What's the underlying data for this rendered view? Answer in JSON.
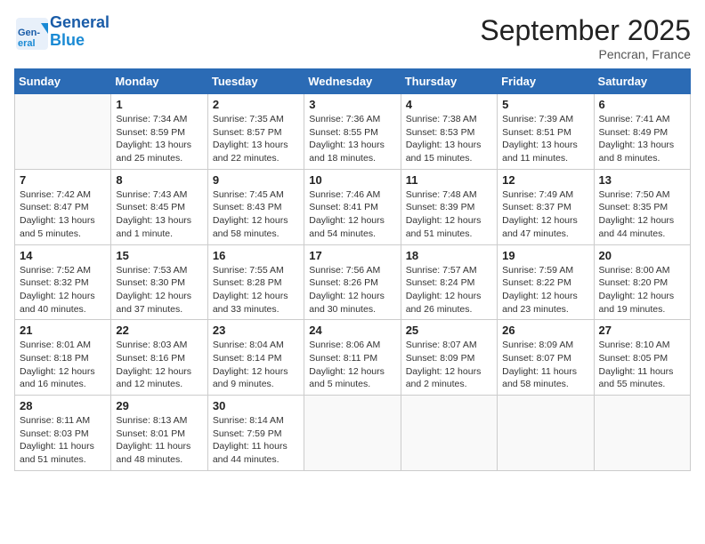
{
  "header": {
    "logo_general": "General",
    "logo_blue": "Blue",
    "month": "September 2025",
    "location": "Pencran, France"
  },
  "days_of_week": [
    "Sunday",
    "Monday",
    "Tuesday",
    "Wednesday",
    "Thursday",
    "Friday",
    "Saturday"
  ],
  "weeks": [
    [
      {
        "day": "",
        "info": ""
      },
      {
        "day": "1",
        "info": "Sunrise: 7:34 AM\nSunset: 8:59 PM\nDaylight: 13 hours and 25 minutes."
      },
      {
        "day": "2",
        "info": "Sunrise: 7:35 AM\nSunset: 8:57 PM\nDaylight: 13 hours and 22 minutes."
      },
      {
        "day": "3",
        "info": "Sunrise: 7:36 AM\nSunset: 8:55 PM\nDaylight: 13 hours and 18 minutes."
      },
      {
        "day": "4",
        "info": "Sunrise: 7:38 AM\nSunset: 8:53 PM\nDaylight: 13 hours and 15 minutes."
      },
      {
        "day": "5",
        "info": "Sunrise: 7:39 AM\nSunset: 8:51 PM\nDaylight: 13 hours and 11 minutes."
      },
      {
        "day": "6",
        "info": "Sunrise: 7:41 AM\nSunset: 8:49 PM\nDaylight: 13 hours and 8 minutes."
      }
    ],
    [
      {
        "day": "7",
        "info": "Sunrise: 7:42 AM\nSunset: 8:47 PM\nDaylight: 13 hours and 5 minutes."
      },
      {
        "day": "8",
        "info": "Sunrise: 7:43 AM\nSunset: 8:45 PM\nDaylight: 13 hours and 1 minute."
      },
      {
        "day": "9",
        "info": "Sunrise: 7:45 AM\nSunset: 8:43 PM\nDaylight: 12 hours and 58 minutes."
      },
      {
        "day": "10",
        "info": "Sunrise: 7:46 AM\nSunset: 8:41 PM\nDaylight: 12 hours and 54 minutes."
      },
      {
        "day": "11",
        "info": "Sunrise: 7:48 AM\nSunset: 8:39 PM\nDaylight: 12 hours and 51 minutes."
      },
      {
        "day": "12",
        "info": "Sunrise: 7:49 AM\nSunset: 8:37 PM\nDaylight: 12 hours and 47 minutes."
      },
      {
        "day": "13",
        "info": "Sunrise: 7:50 AM\nSunset: 8:35 PM\nDaylight: 12 hours and 44 minutes."
      }
    ],
    [
      {
        "day": "14",
        "info": "Sunrise: 7:52 AM\nSunset: 8:32 PM\nDaylight: 12 hours and 40 minutes."
      },
      {
        "day": "15",
        "info": "Sunrise: 7:53 AM\nSunset: 8:30 PM\nDaylight: 12 hours and 37 minutes."
      },
      {
        "day": "16",
        "info": "Sunrise: 7:55 AM\nSunset: 8:28 PM\nDaylight: 12 hours and 33 minutes."
      },
      {
        "day": "17",
        "info": "Sunrise: 7:56 AM\nSunset: 8:26 PM\nDaylight: 12 hours and 30 minutes."
      },
      {
        "day": "18",
        "info": "Sunrise: 7:57 AM\nSunset: 8:24 PM\nDaylight: 12 hours and 26 minutes."
      },
      {
        "day": "19",
        "info": "Sunrise: 7:59 AM\nSunset: 8:22 PM\nDaylight: 12 hours and 23 minutes."
      },
      {
        "day": "20",
        "info": "Sunrise: 8:00 AM\nSunset: 8:20 PM\nDaylight: 12 hours and 19 minutes."
      }
    ],
    [
      {
        "day": "21",
        "info": "Sunrise: 8:01 AM\nSunset: 8:18 PM\nDaylight: 12 hours and 16 minutes."
      },
      {
        "day": "22",
        "info": "Sunrise: 8:03 AM\nSunset: 8:16 PM\nDaylight: 12 hours and 12 minutes."
      },
      {
        "day": "23",
        "info": "Sunrise: 8:04 AM\nSunset: 8:14 PM\nDaylight: 12 hours and 9 minutes."
      },
      {
        "day": "24",
        "info": "Sunrise: 8:06 AM\nSunset: 8:11 PM\nDaylight: 12 hours and 5 minutes."
      },
      {
        "day": "25",
        "info": "Sunrise: 8:07 AM\nSunset: 8:09 PM\nDaylight: 12 hours and 2 minutes."
      },
      {
        "day": "26",
        "info": "Sunrise: 8:09 AM\nSunset: 8:07 PM\nDaylight: 11 hours and 58 minutes."
      },
      {
        "day": "27",
        "info": "Sunrise: 8:10 AM\nSunset: 8:05 PM\nDaylight: 11 hours and 55 minutes."
      }
    ],
    [
      {
        "day": "28",
        "info": "Sunrise: 8:11 AM\nSunset: 8:03 PM\nDaylight: 11 hours and 51 minutes."
      },
      {
        "day": "29",
        "info": "Sunrise: 8:13 AM\nSunset: 8:01 PM\nDaylight: 11 hours and 48 minutes."
      },
      {
        "day": "30",
        "info": "Sunrise: 8:14 AM\nSunset: 7:59 PM\nDaylight: 11 hours and 44 minutes."
      },
      {
        "day": "",
        "info": ""
      },
      {
        "day": "",
        "info": ""
      },
      {
        "day": "",
        "info": ""
      },
      {
        "day": "",
        "info": ""
      }
    ]
  ]
}
